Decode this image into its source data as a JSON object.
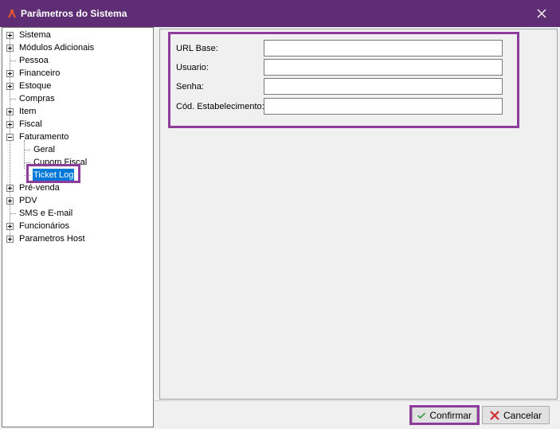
{
  "window": {
    "title": "Parâmetros do Sistema",
    "app_icon": "tool-icon",
    "close_icon": "close-icon"
  },
  "tree": [
    {
      "label": "Sistema",
      "expander": "plus"
    },
    {
      "label": "Módulos Adicionais",
      "expander": "plus"
    },
    {
      "label": "Pessoa",
      "expander": "none"
    },
    {
      "label": "Financeiro",
      "expander": "plus"
    },
    {
      "label": "Estoque",
      "expander": "plus"
    },
    {
      "label": "Compras",
      "expander": "none"
    },
    {
      "label": "Item",
      "expander": "plus"
    },
    {
      "label": "Fiscal",
      "expander": "plus"
    },
    {
      "label": "Faturamento",
      "expander": "minus"
    },
    {
      "label": "Geral",
      "expander": "child"
    },
    {
      "label": "Cupom Fiscal",
      "expander": "child"
    },
    {
      "label": "Ticket Log",
      "expander": "child",
      "selected": true
    },
    {
      "label": "Pré-venda",
      "expander": "plus"
    },
    {
      "label": "PDV",
      "expander": "plus"
    },
    {
      "label": "SMS e E-mail",
      "expander": "none"
    },
    {
      "label": "Funcionários",
      "expander": "plus"
    },
    {
      "label": "Parametros Host",
      "expander": "plus"
    }
  ],
  "form": {
    "url_base": {
      "label": "URL Base:",
      "value": ""
    },
    "usuario": {
      "label": "Usuario:",
      "value": ""
    },
    "senha": {
      "label": "Senha:",
      "value": ""
    },
    "cod_estabelecimento": {
      "label": "Cód. Estabelecimento:",
      "value": ""
    }
  },
  "buttons": {
    "confirmar": {
      "label": "Confirmar",
      "icon": "checkmark-icon",
      "color": "#3a9a3a"
    },
    "cancelar": {
      "label": "Cancelar",
      "icon": "x-icon",
      "color": "#d03030"
    }
  },
  "colors": {
    "titlebar": "#5e2d74",
    "highlight": "#8e3c9c",
    "selection": "#0078d7"
  }
}
